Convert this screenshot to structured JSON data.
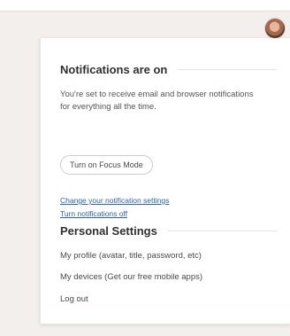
{
  "notifications": {
    "title": "Notifications are on",
    "description": "You're set to receive email and browser notifications for everything all the time.",
    "focus_button": "Turn on Focus Mode",
    "change_link": "Change your notification settings",
    "off_link": "Turn notifications off"
  },
  "personal_settings": {
    "title": "Personal Settings",
    "items": [
      "My profile (avatar, title, password, etc)",
      "My devices (Get our free mobile apps)",
      "Log out"
    ]
  },
  "icons": {
    "avatar": "user-avatar"
  }
}
